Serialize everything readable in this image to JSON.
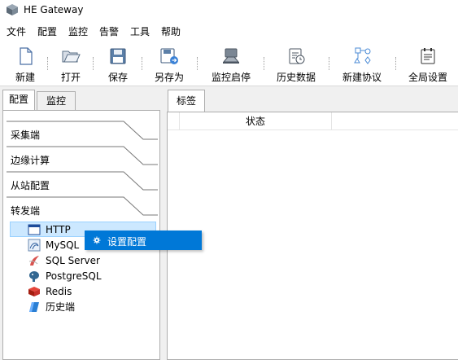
{
  "window": {
    "title": "HE Gateway",
    "icon": "app-cube-icon"
  },
  "menubar": [
    "文件",
    "配置",
    "监控",
    "告警",
    "工具",
    "帮助"
  ],
  "toolbar": [
    {
      "label": "新建",
      "icon": "new-file-icon"
    },
    {
      "label": "打开",
      "icon": "open-folder-icon"
    },
    {
      "label": "保存",
      "icon": "save-disk-icon"
    },
    {
      "label": "另存为",
      "icon": "save-as-icon"
    },
    {
      "label": "监控启停",
      "icon": "monitor-toggle-icon"
    },
    {
      "label": "历史数据",
      "icon": "history-data-icon"
    },
    {
      "label": "新建协议",
      "icon": "new-protocol-icon"
    },
    {
      "label": "全局设置",
      "icon": "global-settings-icon"
    }
  ],
  "left_tabs": [
    {
      "label": "配置",
      "active": true
    },
    {
      "label": "监控",
      "active": false
    }
  ],
  "sections": [
    "采集端",
    "边缘计算",
    "从站配置",
    "转发端"
  ],
  "tree": [
    {
      "label": "HTTP",
      "icon": "http-window-icon",
      "selected": true
    },
    {
      "label": "MySQL",
      "icon": "mysql-dolphin-icon",
      "selected": false
    },
    {
      "label": "SQL Server",
      "icon": "sqlserver-icon",
      "selected": false
    },
    {
      "label": "PostgreSQL",
      "icon": "postgresql-elephant-icon",
      "selected": false
    },
    {
      "label": "Redis",
      "icon": "redis-cube-icon",
      "selected": false
    },
    {
      "label": "历史端",
      "icon": "history-end-icon",
      "selected": false
    }
  ],
  "right_tab": {
    "label": "标签"
  },
  "table": {
    "columns": [
      "",
      "状态",
      ""
    ]
  },
  "context_menu": {
    "items": [
      {
        "label": "设置配置",
        "icon": "gear-icon"
      }
    ]
  },
  "colors": {
    "selection": "#cce8ff",
    "menu_highlight": "#0078d7"
  }
}
